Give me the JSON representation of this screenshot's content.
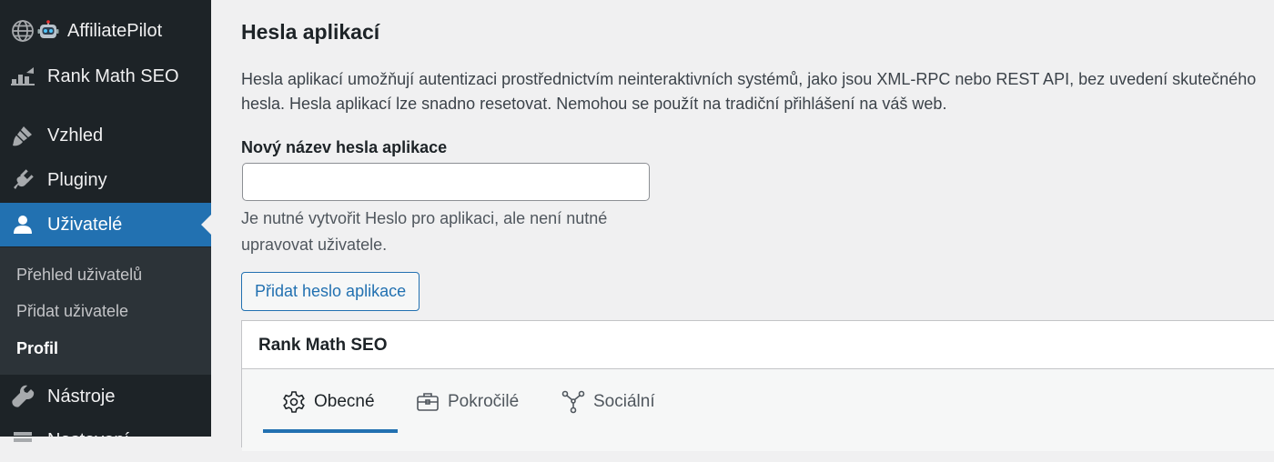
{
  "sidebar": {
    "items": [
      {
        "label": "AffiliatePilot",
        "icon": "globe-icon"
      },
      {
        "label": "Rank Math SEO",
        "icon": "rank-math-icon"
      },
      {
        "label": "Vzhled",
        "icon": "brush-icon"
      },
      {
        "label": "Pluginy",
        "icon": "plugin-icon"
      },
      {
        "label": "Uživatelé",
        "icon": "user-icon",
        "active": true
      },
      {
        "label": "Nástroje",
        "icon": "wrench-icon"
      },
      {
        "label": "Nastavení",
        "icon": "settings-icon"
      }
    ],
    "affiliate_emoji": "🤖",
    "submenu": [
      {
        "label": "Přehled uživatelů"
      },
      {
        "label": "Přidat uživatele"
      },
      {
        "label": "Profil",
        "current": true
      }
    ]
  },
  "main": {
    "title": "Hesla aplikací",
    "description": "Hesla aplikací umožňují autentizaci prostřednictvím neinteraktivních systémů, jako jsou XML-RPC nebo REST API, bez uvedení skutečného hesla. Hesla aplikací lze snadno resetovat. Nemohou se použít na tradiční přihlášení na váš web.",
    "new_password_label": "Nový název hesla aplikace",
    "new_password_value": "",
    "help_text": "Je nutné vytvořit Heslo pro aplikaci, ale není nutné upravovat uživatele.",
    "add_button_label": "Přidat heslo aplikace"
  },
  "rank_math_panel": {
    "title": "Rank Math SEO",
    "tabs": [
      {
        "label": "Obecné",
        "icon": "gear-icon",
        "active": true
      },
      {
        "label": "Pokročilé",
        "icon": "briefcase-icon"
      },
      {
        "label": "Sociální",
        "icon": "share-icon"
      }
    ]
  },
  "colors": {
    "sidebar_bg": "#1d2327",
    "submenu_bg": "#2c3338",
    "accent": "#2271b1",
    "page_bg": "#f0f0f1"
  }
}
